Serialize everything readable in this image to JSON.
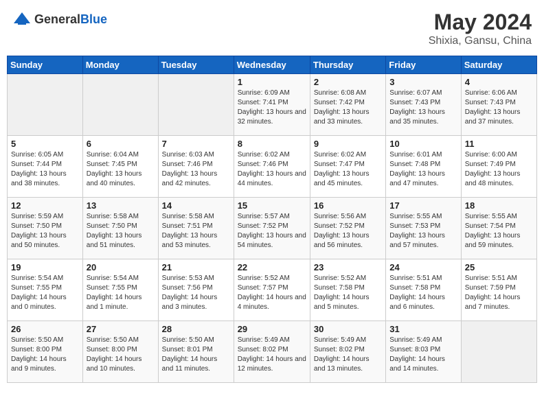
{
  "header": {
    "logo_general": "General",
    "logo_blue": "Blue",
    "month": "May 2024",
    "location": "Shixia, Gansu, China"
  },
  "days_of_week": [
    "Sunday",
    "Monday",
    "Tuesday",
    "Wednesday",
    "Thursday",
    "Friday",
    "Saturday"
  ],
  "weeks": [
    [
      {
        "day": "",
        "info": ""
      },
      {
        "day": "",
        "info": ""
      },
      {
        "day": "",
        "info": ""
      },
      {
        "day": "1",
        "info": "Sunrise: 6:09 AM\nSunset: 7:41 PM\nDaylight: 13 hours\nand 32 minutes."
      },
      {
        "day": "2",
        "info": "Sunrise: 6:08 AM\nSunset: 7:42 PM\nDaylight: 13 hours\nand 33 minutes."
      },
      {
        "day": "3",
        "info": "Sunrise: 6:07 AM\nSunset: 7:43 PM\nDaylight: 13 hours\nand 35 minutes."
      },
      {
        "day": "4",
        "info": "Sunrise: 6:06 AM\nSunset: 7:43 PM\nDaylight: 13 hours\nand 37 minutes."
      }
    ],
    [
      {
        "day": "5",
        "info": "Sunrise: 6:05 AM\nSunset: 7:44 PM\nDaylight: 13 hours\nand 38 minutes."
      },
      {
        "day": "6",
        "info": "Sunrise: 6:04 AM\nSunset: 7:45 PM\nDaylight: 13 hours\nand 40 minutes."
      },
      {
        "day": "7",
        "info": "Sunrise: 6:03 AM\nSunset: 7:46 PM\nDaylight: 13 hours\nand 42 minutes."
      },
      {
        "day": "8",
        "info": "Sunrise: 6:02 AM\nSunset: 7:46 PM\nDaylight: 13 hours\nand 44 minutes."
      },
      {
        "day": "9",
        "info": "Sunrise: 6:02 AM\nSunset: 7:47 PM\nDaylight: 13 hours\nand 45 minutes."
      },
      {
        "day": "10",
        "info": "Sunrise: 6:01 AM\nSunset: 7:48 PM\nDaylight: 13 hours\nand 47 minutes."
      },
      {
        "day": "11",
        "info": "Sunrise: 6:00 AM\nSunset: 7:49 PM\nDaylight: 13 hours\nand 48 minutes."
      }
    ],
    [
      {
        "day": "12",
        "info": "Sunrise: 5:59 AM\nSunset: 7:50 PM\nDaylight: 13 hours\nand 50 minutes."
      },
      {
        "day": "13",
        "info": "Sunrise: 5:58 AM\nSunset: 7:50 PM\nDaylight: 13 hours\nand 51 minutes."
      },
      {
        "day": "14",
        "info": "Sunrise: 5:58 AM\nSunset: 7:51 PM\nDaylight: 13 hours\nand 53 minutes."
      },
      {
        "day": "15",
        "info": "Sunrise: 5:57 AM\nSunset: 7:52 PM\nDaylight: 13 hours\nand 54 minutes."
      },
      {
        "day": "16",
        "info": "Sunrise: 5:56 AM\nSunset: 7:52 PM\nDaylight: 13 hours\nand 56 minutes."
      },
      {
        "day": "17",
        "info": "Sunrise: 5:55 AM\nSunset: 7:53 PM\nDaylight: 13 hours\nand 57 minutes."
      },
      {
        "day": "18",
        "info": "Sunrise: 5:55 AM\nSunset: 7:54 PM\nDaylight: 13 hours\nand 59 minutes."
      }
    ],
    [
      {
        "day": "19",
        "info": "Sunrise: 5:54 AM\nSunset: 7:55 PM\nDaylight: 14 hours\nand 0 minutes."
      },
      {
        "day": "20",
        "info": "Sunrise: 5:54 AM\nSunset: 7:55 PM\nDaylight: 14 hours\nand 1 minute."
      },
      {
        "day": "21",
        "info": "Sunrise: 5:53 AM\nSunset: 7:56 PM\nDaylight: 14 hours\nand 3 minutes."
      },
      {
        "day": "22",
        "info": "Sunrise: 5:52 AM\nSunset: 7:57 PM\nDaylight: 14 hours\nand 4 minutes."
      },
      {
        "day": "23",
        "info": "Sunrise: 5:52 AM\nSunset: 7:58 PM\nDaylight: 14 hours\nand 5 minutes."
      },
      {
        "day": "24",
        "info": "Sunrise: 5:51 AM\nSunset: 7:58 PM\nDaylight: 14 hours\nand 6 minutes."
      },
      {
        "day": "25",
        "info": "Sunrise: 5:51 AM\nSunset: 7:59 PM\nDaylight: 14 hours\nand 7 minutes."
      }
    ],
    [
      {
        "day": "26",
        "info": "Sunrise: 5:50 AM\nSunset: 8:00 PM\nDaylight: 14 hours\nand 9 minutes."
      },
      {
        "day": "27",
        "info": "Sunrise: 5:50 AM\nSunset: 8:00 PM\nDaylight: 14 hours\nand 10 minutes."
      },
      {
        "day": "28",
        "info": "Sunrise: 5:50 AM\nSunset: 8:01 PM\nDaylight: 14 hours\nand 11 minutes."
      },
      {
        "day": "29",
        "info": "Sunrise: 5:49 AM\nSunset: 8:02 PM\nDaylight: 14 hours\nand 12 minutes."
      },
      {
        "day": "30",
        "info": "Sunrise: 5:49 AM\nSunset: 8:02 PM\nDaylight: 14 hours\nand 13 minutes."
      },
      {
        "day": "31",
        "info": "Sunrise: 5:49 AM\nSunset: 8:03 PM\nDaylight: 14 hours\nand 14 minutes."
      },
      {
        "day": "",
        "info": ""
      }
    ]
  ]
}
